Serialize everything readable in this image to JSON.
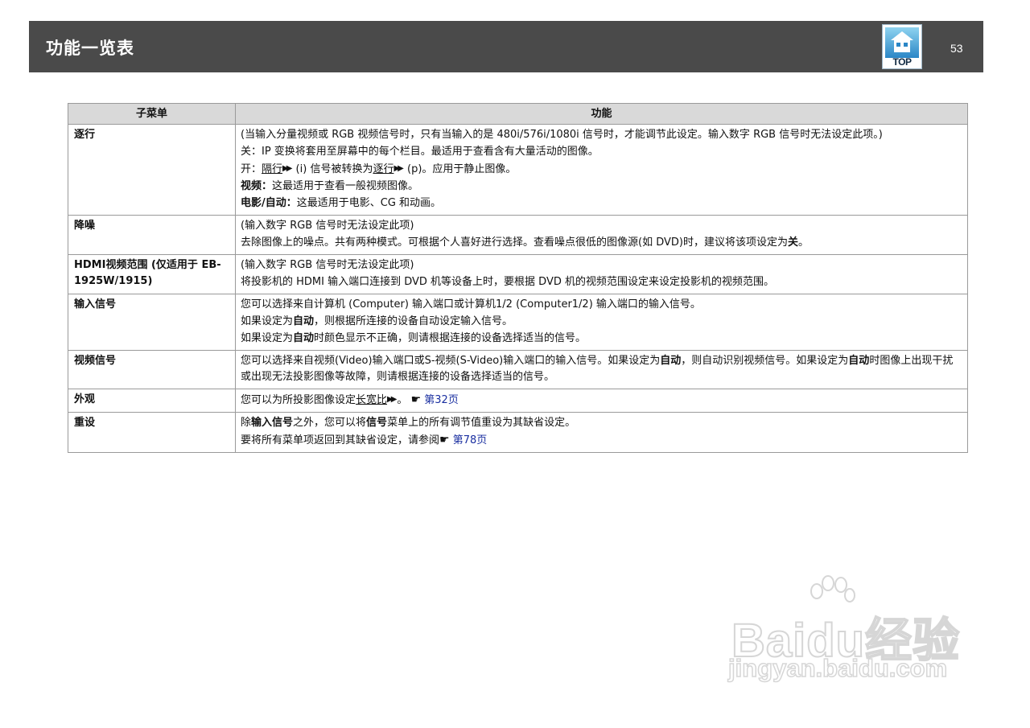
{
  "header": {
    "title": "功能一览表",
    "top_button": "TOP",
    "page_number": "53"
  },
  "table": {
    "columns": [
      "子菜单",
      "功能"
    ],
    "rows": [
      {
        "submenu": "逐行",
        "lines": [
          "(当输入分量视频或 RGB 视频信号时，只有当输入的是 480i/576i/1080i 信号时，才能调节此设定。输入数字 RGB 信号时无法设定此项。)",
          "关：IP 变换将套用至屏幕中的每个栏目。最适用于查看含有大量活动的图像。",
          {
            "before": "开：",
            "link1": "隔行",
            "middle": " (i) 信号被转换为",
            "link2": "逐行",
            "after": " (p)。应用于静止图像。"
          },
          {
            "bold": "视频：",
            "text": "这最适用于查看一般视频图像。"
          },
          {
            "bold": "电影/自动：",
            "text": "这最适用于电影、CG 和动画。"
          }
        ]
      },
      {
        "submenu": "降噪",
        "lines": [
          "(输入数字 RGB 信号时无法设定此项)",
          {
            "text": "去除图像上的噪点。共有两种模式。可根据个人喜好进行选择。查看噪点很低的图像源(如 DVD)时，建议将该项设定为",
            "bold": "关",
            "after": "。"
          }
        ]
      },
      {
        "submenu": "HDMI视频范围 (仅适用于 EB-1925W/1915)",
        "lines": [
          "(输入数字 RGB 信号时无法设定此项)",
          "将投影机的 HDMI 输入端口连接到 DVD 机等设备上时，要根据 DVD 机的视频范围设定来设定投影机的视频范围。"
        ]
      },
      {
        "submenu": "输入信号",
        "lines": [
          "您可以选择来自计算机 (Computer) 输入端口或计算机1/2 (Computer1/2) 输入端口的输入信号。",
          {
            "text": "如果设定为",
            "bold": "自动",
            "after": "，则根据所连接的设备自动设定输入信号。"
          },
          {
            "text": "如果设定为",
            "bold": "自动",
            "after": "时颜色显示不正确，则请根据连接的设备选择适当的信号。"
          }
        ]
      },
      {
        "submenu": "视频信号",
        "lines": [
          {
            "text": "您可以选择来自视频(Video)输入端口或S-视频(S-Video)输入端口的输入信号。如果设定为",
            "bold": "自动",
            "middle": "，则自动识别视频信号。如果设定为",
            "bold2": "自动",
            "after": "时图像上出现干扰或出现无法投影图像等故障，则请根据连接的设备选择适当的信号。"
          }
        ]
      },
      {
        "submenu": "外观",
        "lines": [
          {
            "text": "您可以为所投影图像设定",
            "link": "长宽比",
            "after": "。",
            "ref": "第32页"
          }
        ]
      },
      {
        "submenu": "重设",
        "lines": [
          {
            "text": "除",
            "bold": "输入信号",
            "middle": "之外，您可以将",
            "bold2": "信号",
            "after": "菜单上的所有调节值重设为其缺省设定。"
          },
          {
            "text": "要将所有菜单项返回到其缺省设定，请参阅",
            "ref": "第78页"
          }
        ]
      }
    ]
  },
  "watermark": {
    "main": "Baidu经验",
    "sub": "jingyan.baidu.com"
  },
  "colors": {
    "header_bg": "#4a4a4a",
    "table_header_bg": "#d9d9d9",
    "border": "#9a9a9a",
    "link_ref": "#1a2fa0"
  },
  "icons": {
    "top_button": "house-top-icon",
    "glossary_marker": "double-arrow-icon",
    "reference_marker": "pointing-hand-icon"
  }
}
